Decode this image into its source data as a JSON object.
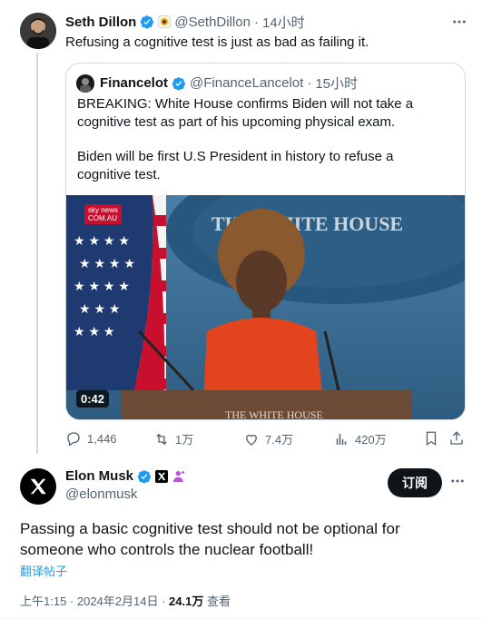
{
  "colors": {
    "verified": "#1d9bf0",
    "text": "#0f1419",
    "muted": "#536471",
    "link": "#1d9bf0"
  },
  "seth": {
    "name": "Seth Dillon",
    "handle": "@SethDillon",
    "time": "14小时",
    "text": "Refusing a cognitive test is just as bad as failing it."
  },
  "quote": {
    "name": "Financelot",
    "handle": "@FinanceLancelot",
    "time": "15小时",
    "para1": "BREAKING: White House confirms Biden will not take a cognitive test as part of his upcoming physical exam.",
    "para2": "Biden will be first U.S President in history to refuse a cognitive test.",
    "video_duration": "0:42",
    "media_banner_top": "THE WHITE HOUSE",
    "media_banner_bottom": "THE WHITE HOUSE",
    "sky_logo_line1": "sky",
    "sky_logo_line2": "news",
    "sky_logo_line3": "COM.AU"
  },
  "actions": {
    "replies": "1,446",
    "retweets": "1万",
    "likes": "7.4万",
    "views": "420万"
  },
  "elon": {
    "name": "Elon Musk",
    "handle": "@elonmusk",
    "subscribe_label": "订阅",
    "text": "Passing a basic cognitive test should not be optional for someone who controls the nuclear football!",
    "translate_label": "翻译帖子",
    "timestamp": "上午1:15 · 2024年2月14日 · ",
    "view_count": "24.1万",
    "view_label": " 查看"
  },
  "icons": [
    "more-icon",
    "verified-icon",
    "reply-icon",
    "retweet-icon",
    "like-icon",
    "views-icon",
    "bookmark-icon",
    "share-icon",
    "x-logo-icon"
  ]
}
